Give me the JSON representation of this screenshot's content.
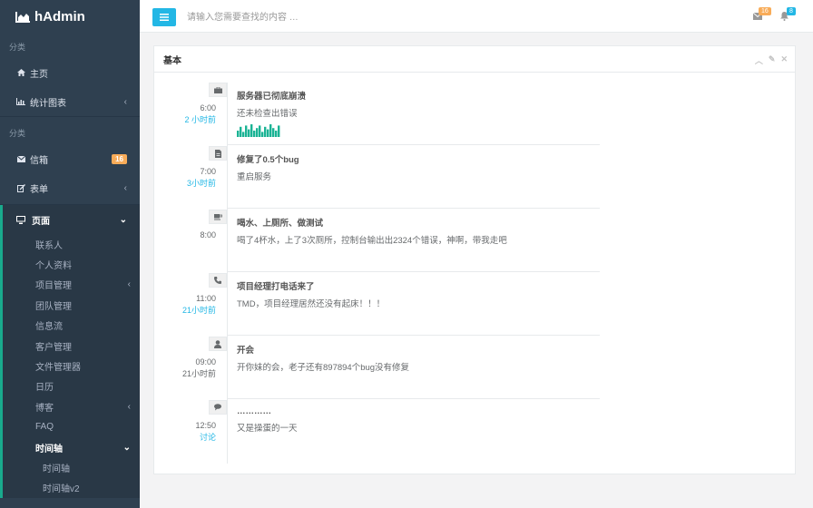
{
  "brand": {
    "name": "hAdmin"
  },
  "sidebar": {
    "header1": "分类",
    "home": "主页",
    "charts": "统计图表",
    "header2": "分类",
    "mailbox": {
      "label": "信箱",
      "badge": "16"
    },
    "forms": "表单",
    "pages": {
      "label": "页面",
      "items": [
        "联系人",
        "个人资料",
        "项目管理",
        "团队管理",
        "信息流",
        "客户管理",
        "文件管理器",
        "日历",
        "博客",
        "FAQ",
        "时间轴"
      ],
      "timeline_sub": [
        "时间轴",
        "时间轴v2"
      ]
    }
  },
  "topbar": {
    "search_placeholder": "请输入您需要查找的内容 …",
    "mail_count": "16",
    "bell_count": "8",
    "colors": {
      "mail_badge": "#f8ac59",
      "bell_badge": "#23b7e5"
    }
  },
  "panel": {
    "title": "基本",
    "events": [
      {
        "icon": "briefcase-icon",
        "time": "6:00",
        "relative": "2 小时前",
        "title": "服务器已彻底崩溃",
        "text": "还未检查出错误",
        "sparkline": [
          5,
          8,
          4,
          9,
          6,
          10,
          5,
          7,
          9,
          4,
          8,
          6,
          10,
          7,
          5,
          9
        ]
      },
      {
        "icon": "file-icon",
        "time": "7:00",
        "relative": "3小时前",
        "title": "修复了0.5个bug",
        "text": "重启服务"
      },
      {
        "icon": "coffee-icon",
        "time": "8:00",
        "relative": "",
        "title": "喝水、上厕所、做测试",
        "text": "喝了4杯水，上了3次厕所，控制台输出出2324个错误，神啊，带我走吧"
      },
      {
        "icon": "phone-icon",
        "time": "11:00",
        "relative": "21小时前",
        "title": "项目经理打电话来了",
        "text": "TMD，项目经理居然还没有起床！！！"
      },
      {
        "icon": "user-icon",
        "time": "09:00",
        "relative": "21小时前",
        "title": "开会",
        "text": "开你妹的会，老子还有897894个bug没有修复"
      },
      {
        "icon": "comments-icon",
        "time": "12:50",
        "relative": "讨论",
        "title": "…………",
        "text": "又是操蛋的一天"
      }
    ]
  }
}
